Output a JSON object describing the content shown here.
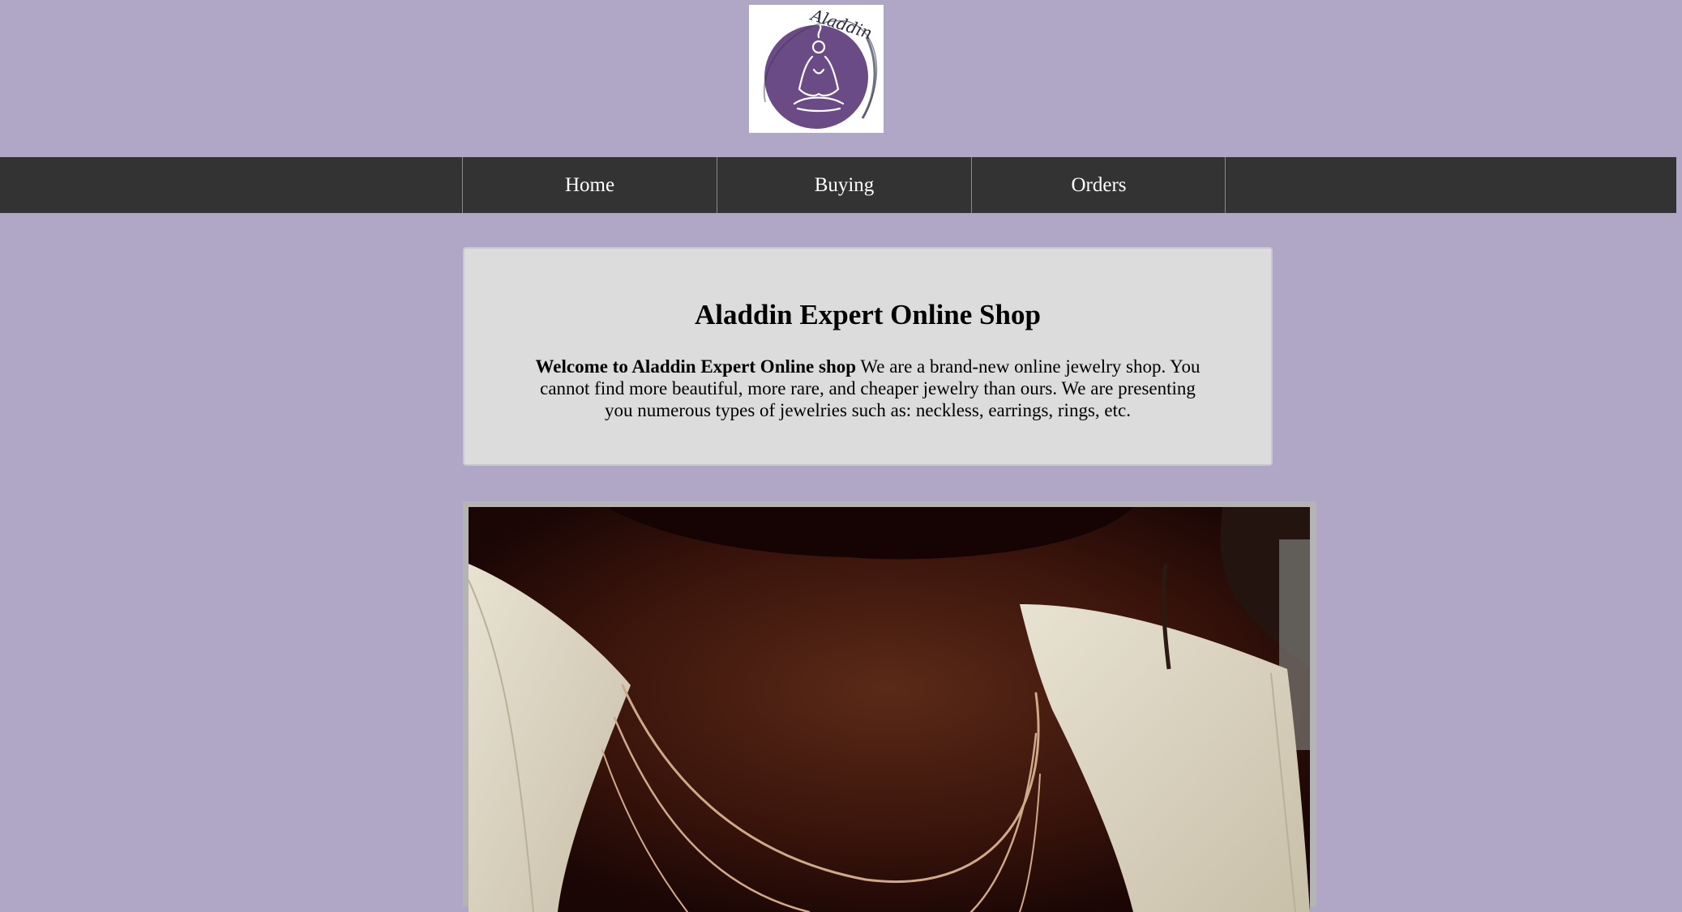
{
  "logo": {
    "text": "Aladdin",
    "icon": "meditating-figure-logo",
    "colors": {
      "circle": "#6b4b85",
      "ink": "#2b2b40"
    }
  },
  "nav": {
    "items": [
      {
        "label": "Home"
      },
      {
        "label": "Buying"
      },
      {
        "label": "Orders"
      }
    ]
  },
  "intro": {
    "title": "Aladdin Expert Online Shop",
    "lead": "Welcome to Aladdin Expert Online shop",
    "body": " We are a brand-new online jewelry shop. You cannot find more beautiful, more rare, and cheaper jewelry than ours. We are presenting you numerous types of jewelries such as: neckless, earrings, rings, etc."
  },
  "hero": {
    "subject": "necklace-photo"
  },
  "colors": {
    "page_background": "#b0a6c5",
    "navbar": "#333333",
    "panel": "#dcdcdc"
  }
}
